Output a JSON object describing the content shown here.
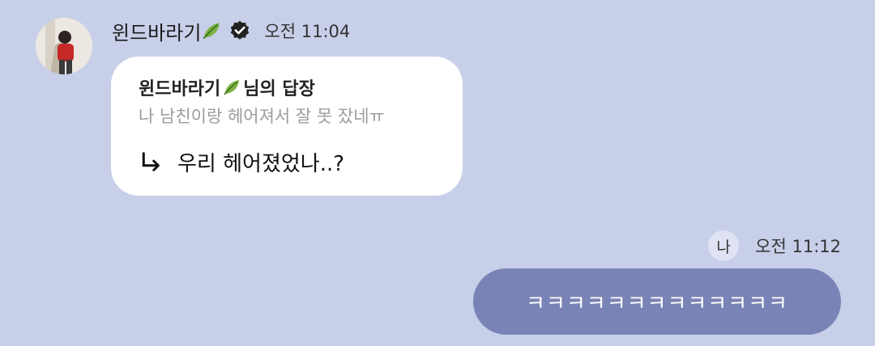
{
  "incoming": {
    "sender_name": "윈드바라기",
    "time": "오전 11:04",
    "reply": {
      "quoted_name": "윈드바라기",
      "quoted_suffix": "님의 답장",
      "quoted_text": "나 남친이랑 헤어져서 잘 못 잤네ㅠ",
      "message": "우리 헤어졌었나..?"
    }
  },
  "outgoing": {
    "me_label": "나",
    "time": "오전 11:12",
    "message": "ㅋㅋㅋㅋㅋㅋㅋㅋㅋㅋㅋㅋㅋ"
  },
  "icons": {
    "leaf": "leaf-icon",
    "verified": "verified-badge-icon",
    "reply_arrow": "reply-arrow-icon"
  },
  "colors": {
    "background": "#c8cfe9",
    "outgoing_bubble": "#7a83b5",
    "incoming_bubble": "#ffffff"
  }
}
